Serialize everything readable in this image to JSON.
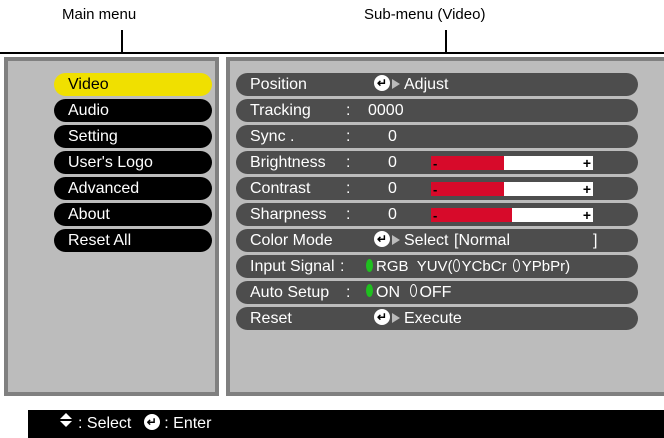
{
  "callouts": {
    "main_menu": "Main menu",
    "sub_menu": "Sub-menu (Video)"
  },
  "main_menu": {
    "items": [
      {
        "label": "Video",
        "selected": true
      },
      {
        "label": "Audio"
      },
      {
        "label": "Setting"
      },
      {
        "label": "User's Logo"
      },
      {
        "label": "Advanced"
      },
      {
        "label": "About"
      },
      {
        "label": "Reset All"
      }
    ]
  },
  "sub_menu": {
    "position": {
      "label": "Position",
      "action": "Adjust"
    },
    "tracking": {
      "label": "Tracking",
      "colon": ":",
      "value": "0000"
    },
    "sync": {
      "label": "Sync .",
      "colon": ":",
      "value": "0"
    },
    "brightness": {
      "label": "Brightness",
      "colon": ":",
      "value": "0",
      "level_percent": 45
    },
    "contrast": {
      "label": "Contrast",
      "colon": ":",
      "value": "0",
      "level_percent": 45
    },
    "sharpness": {
      "label": "Sharpness",
      "colon": ":",
      "value": "0",
      "level_percent": 50
    },
    "color_mode": {
      "label": "Color Mode",
      "action": "Select",
      "current": "[Normal",
      "close": "]"
    },
    "input_signal": {
      "label": "Input Signal",
      "colon": ":",
      "options": [
        "RGB",
        "YUV(",
        "YCbCr",
        "YPbPr)"
      ],
      "selected": "RGB"
    },
    "auto_setup": {
      "label": "Auto Setup",
      "colon": ":",
      "options": [
        "ON",
        "OFF"
      ],
      "selected": "ON"
    },
    "reset": {
      "label": "Reset",
      "action": "Execute"
    }
  },
  "bottom_bar": {
    "select_label": ": Select",
    "enter_label": ": Enter"
  },
  "colors": {
    "selected_item": "#f0e000",
    "bar_fill": "#d70a2a",
    "radio_on": "#1fc01f",
    "panel_bg": "#bcbcbc"
  }
}
